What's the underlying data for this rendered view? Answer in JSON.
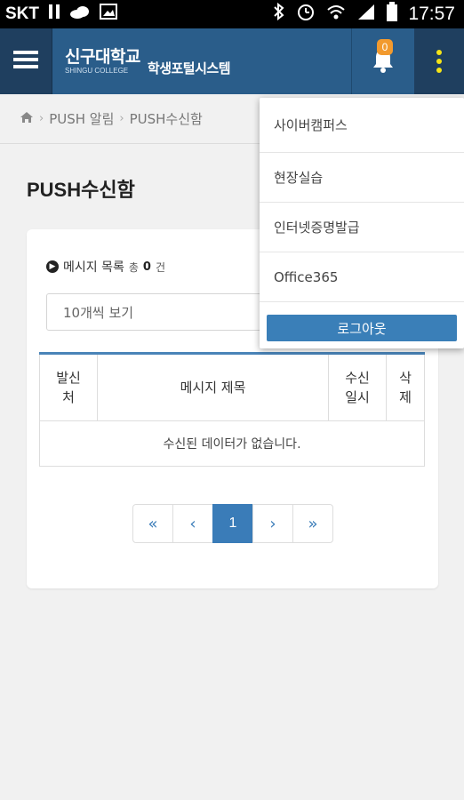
{
  "status_bar": {
    "carrier": "SKT",
    "time": "17:57",
    "icons": [
      "pause-icon",
      "cloud-icon",
      "image-icon",
      "bluetooth-icon",
      "alarm-icon",
      "wifi-icon",
      "signal-icon",
      "battery-icon"
    ]
  },
  "header": {
    "logo_ko": "신구대학교",
    "logo_en": "SHINGU COLLEGE",
    "logo_sub": "학생포털시스템",
    "notification_count": "0",
    "accent": "#2a5d8a",
    "badge_color": "#f29a2e"
  },
  "breadcrumb": {
    "items": [
      "PUSH 알림",
      "PUSH수신함"
    ]
  },
  "page": {
    "title": "PUSH수신함"
  },
  "list": {
    "heading": "메시지 목록",
    "count_prefix": "총",
    "count": "0",
    "count_suffix": "건",
    "per_page": "10개씩 보기"
  },
  "table": {
    "headers": [
      "발신\n처",
      "메시지 제목",
      "수신\n일시",
      "삭\n제"
    ],
    "empty": "수신된 데이터가 없습니다."
  },
  "pagination": {
    "first": "«",
    "prev": "‹",
    "current": "1",
    "next": "›",
    "last": "»"
  },
  "dropdown": {
    "items": [
      "사이버캠퍼스",
      "현장실습",
      "인터넷증명발급",
      "Office365"
    ],
    "logout": "로그아웃"
  }
}
